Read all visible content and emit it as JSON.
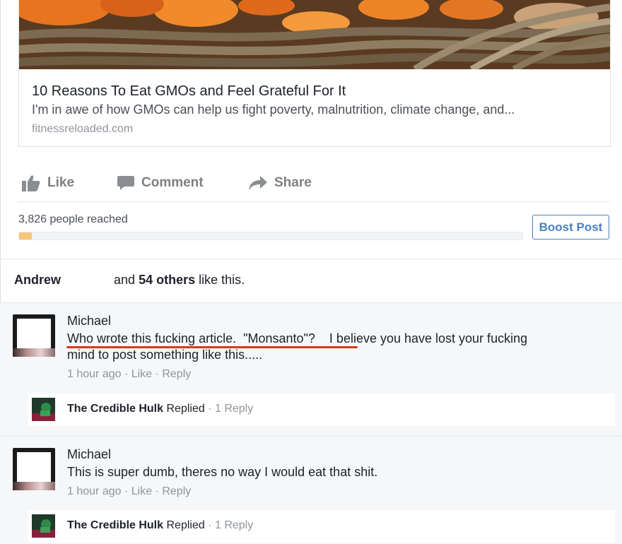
{
  "link_card": {
    "title": "10 Reasons To Eat GMOs and Feel Grateful For It",
    "description": "I'm in awe of how GMOs can help us fight poverty, malnutrition, climate change, and...",
    "domain": "fitnessreloaded.com"
  },
  "actions": {
    "like": "Like",
    "comment": "Comment",
    "share": "Share"
  },
  "reach": {
    "text": "3,826 people reached",
    "progress_fraction": 0.025,
    "boost_label": "Boost Post"
  },
  "likes": {
    "name": "Andrew",
    "and": "and",
    "others": "54 others",
    "suffix": "like this."
  },
  "comments": [
    {
      "author": "Michael",
      "line1": "Who wrote this fucking article.  \"Monsanto\"?    I believe you have lost your fucking",
      "line2": "mind to post something like this.....",
      "time": "1 hour ago",
      "like": "Like",
      "reply": "Reply",
      "sep": "·",
      "reply_summary": {
        "who": "The Credible Hulk",
        "action": "Replied",
        "sep": "·",
        "count": "1 Reply"
      }
    },
    {
      "author": "Michael",
      "line1": "This is super dumb, theres no way I would eat that shit.",
      "time": "1 hour ago",
      "like": "Like",
      "reply": "Reply",
      "sep": "·",
      "reply_summary": {
        "who": "The Credible Hulk",
        "action": "Replied",
        "sep": "·",
        "count": "1 Reply"
      }
    }
  ],
  "colors": {
    "accent_blue": "#4a7fc1",
    "underline_red": "#d9371f",
    "reach_fill": "#f7c57a"
  }
}
